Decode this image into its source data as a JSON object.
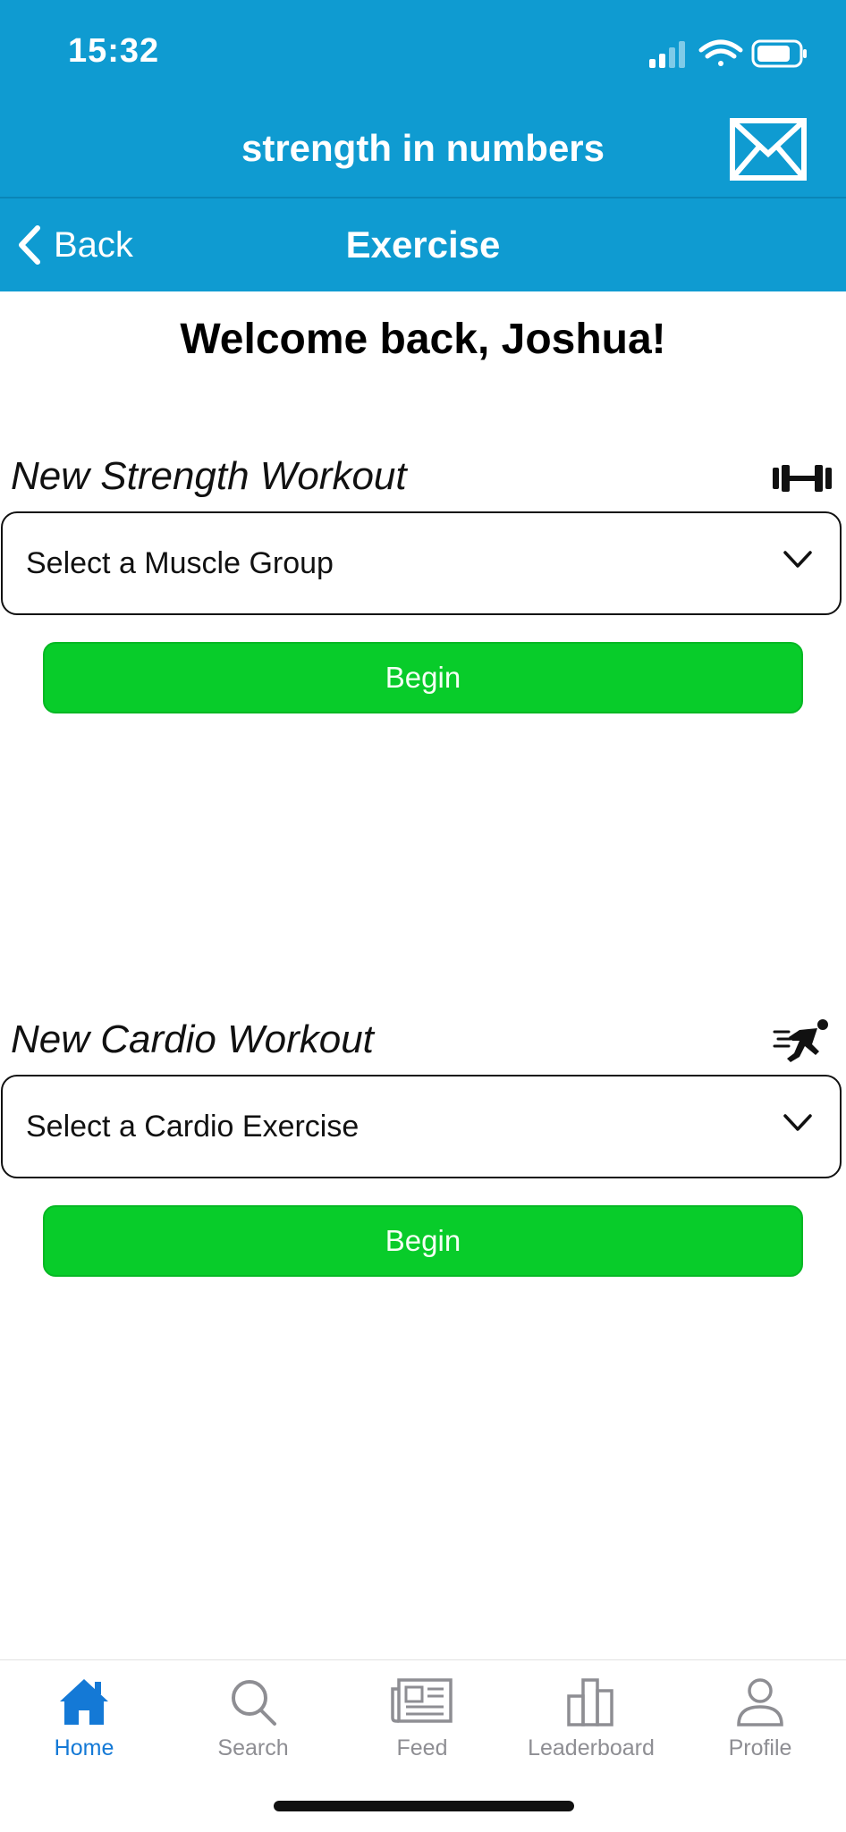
{
  "status_bar": {
    "time": "15:32"
  },
  "header": {
    "app_title": "strength in numbers",
    "mail_icon": "mail-icon"
  },
  "nav": {
    "back_label": "Back",
    "title": "Exercise"
  },
  "welcome": "Welcome back, Joshua!",
  "strength": {
    "title": "New Strength Workout",
    "icon": "dumbbell-icon",
    "select_value": "Select a Muscle Group",
    "button_label": "Begin"
  },
  "cardio": {
    "title": "New Cardio Workout",
    "icon": "runner-icon",
    "select_value": "Select a Cardio Exercise",
    "button_label": "Begin"
  },
  "tabs": [
    {
      "label": "Home",
      "icon": "home-icon",
      "active": true
    },
    {
      "label": "Search",
      "icon": "search-icon",
      "active": false
    },
    {
      "label": "Feed",
      "icon": "newspaper-icon",
      "active": false
    },
    {
      "label": "Leaderboard",
      "icon": "bar-chart-icon",
      "active": false
    },
    {
      "label": "Profile",
      "icon": "person-icon",
      "active": false
    }
  ],
  "colors": {
    "header_blue": "#0f9bd1",
    "begin_green": "#08cc2a",
    "active_tab_blue": "#1479d6",
    "inactive_tab_gray": "#8e8e93"
  }
}
